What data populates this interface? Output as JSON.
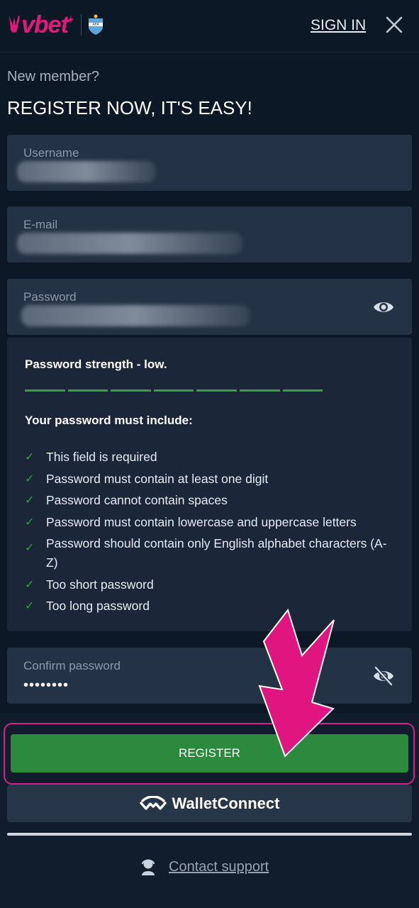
{
  "header": {
    "logo_text": "vbet",
    "signin_label": "SIGN IN",
    "close_icon": "close-icon"
  },
  "intro": {
    "new_member": "New member?",
    "headline": "REGISTER NOW, IT'S EASY!"
  },
  "form": {
    "username": {
      "label": "Username"
    },
    "email": {
      "label": "E-mail"
    },
    "password": {
      "label": "Password",
      "icon": "eye-icon"
    },
    "confirm_password": {
      "label": "Confirm password",
      "value": "••••••••",
      "icon": "eye-off-icon"
    }
  },
  "strength": {
    "title": "Password strength - low.",
    "must_include": "Your password must include:",
    "rules": [
      "This field is required",
      "Password must contain at least one digit",
      "Password cannot contain spaces",
      "Password must contain lowercase and uppercase letters",
      "Password should contain only English alphabet characters (A-Z)",
      "Too short password",
      "Too long password"
    ]
  },
  "actions": {
    "register_label": "REGISTER",
    "walletconnect_label": "WalletConnect",
    "contact_support_label": "Contact support"
  },
  "colors": {
    "accent": "#e1197b",
    "register_green": "#2b8a3b",
    "check_green": "#2ea043",
    "background": "#0d1826"
  }
}
